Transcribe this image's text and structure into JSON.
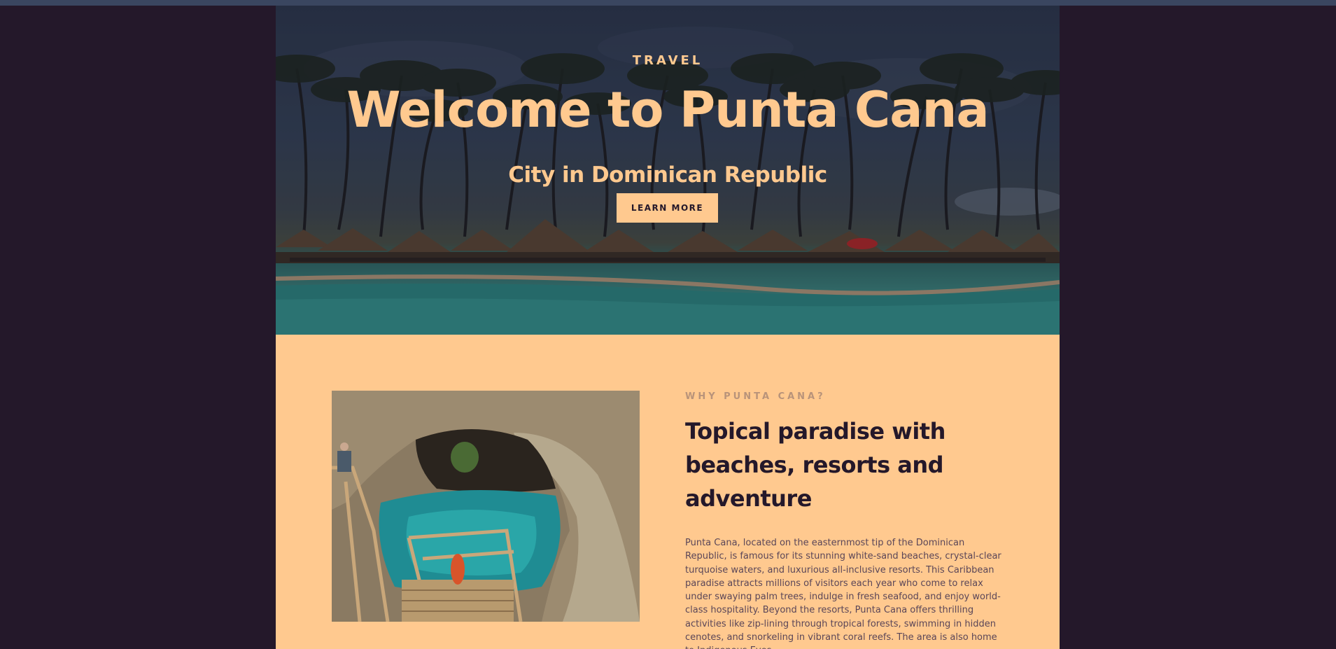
{
  "hero": {
    "eyebrow": "TRAVEL",
    "title": "Welcome to Punta Cana",
    "subtitle": "City in Dominican Republic",
    "button_label": "LEARN MORE"
  },
  "about": {
    "eyebrow": "WHY PUNTA CANA?",
    "heading": "Topical paradise with beaches, resorts and adventure",
    "text": "Punta Cana, located on the easternmost tip of the Dominican Republic, is famous for its stunning white-sand beaches, crystal-clear turquoise waters, and luxurious all-inclusive resorts. This Caribbean paradise attracts millions of visitors each year who come to relax under swaying palm trees, indulge in fresh seafood, and enjoy world-class hospitality. Beyond the resorts, Punta Cana offers thrilling activities like zip-lining through tropical forests, swimming in hidden cenotes, and snorkeling in vibrant coral reefs. The area is also home to Indigenous Eyes"
  },
  "colors": {
    "page_bg": "#24182a",
    "accent": "#ffc98f",
    "dark_text": "#24182a",
    "muted_text": "#5a4658",
    "eyebrow_muted": "#b8937a"
  }
}
